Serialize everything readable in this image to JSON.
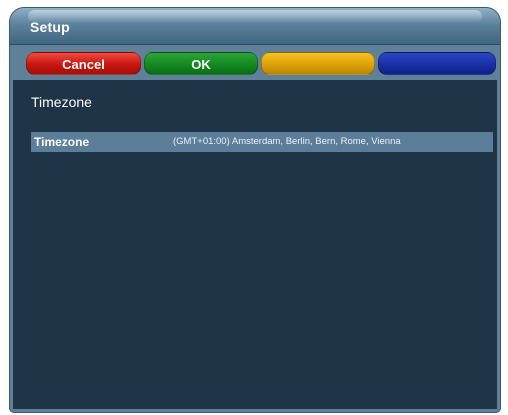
{
  "window": {
    "title": "Setup"
  },
  "buttons": {
    "red_label": "Cancel",
    "green_label": "OK",
    "yellow_label": "",
    "blue_label": ""
  },
  "section": {
    "heading": "Timezone"
  },
  "settings": [
    {
      "label": "Timezone",
      "value": "(GMT+01:00) Amsterdam, Berlin, Bern, Rome, Vienna"
    }
  ]
}
